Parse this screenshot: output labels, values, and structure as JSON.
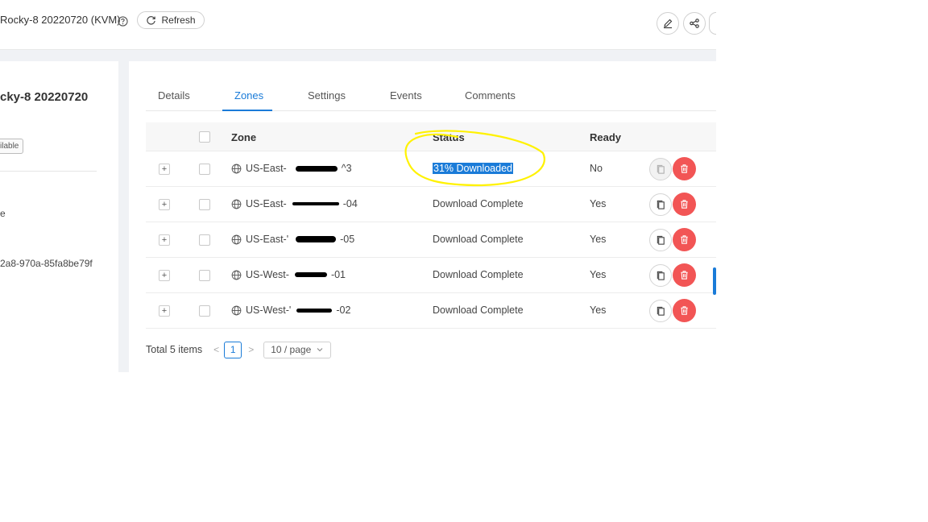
{
  "header": {
    "title": "Rocky-8 20220720 (KVM)",
    "refresh_label": "Refresh"
  },
  "left_panel": {
    "title": "cky-8 20220720",
    "badge": "ilable",
    "text1": "e",
    "text2": "2a8-970a-85fa8be79f"
  },
  "tabs": [
    {
      "label": "Details"
    },
    {
      "label": "Zones",
      "active": true
    },
    {
      "label": "Settings"
    },
    {
      "label": "Events"
    },
    {
      "label": "Comments"
    }
  ],
  "table": {
    "columns": {
      "zone": "Zone",
      "status": "Status",
      "ready": "Ready"
    },
    "rows": [
      {
        "zone_prefix": "US-East-",
        "zone_suffix": "^3",
        "status": "31% Downloaded",
        "ready": "No",
        "highlight": true
      },
      {
        "zone_prefix": "US-East-",
        "zone_suffix": "-04",
        "status": "Download Complete",
        "ready": "Yes"
      },
      {
        "zone_prefix": "US-East-'",
        "zone_suffix": "-05",
        "status": "Download Complete",
        "ready": "Yes"
      },
      {
        "zone_prefix": "US-West-",
        "zone_suffix": "-01",
        "status": "Download Complete",
        "ready": "Yes"
      },
      {
        "zone_prefix": "US-West-'",
        "zone_suffix": "-02",
        "status": "Download Complete",
        "ready": "Yes"
      }
    ]
  },
  "pagination": {
    "total": "Total 5 items",
    "current_page": "1",
    "page_size": "10 / page"
  },
  "colors": {
    "accent": "#1a7bd8",
    "danger": "#f25555",
    "annotation": "#fff200"
  }
}
